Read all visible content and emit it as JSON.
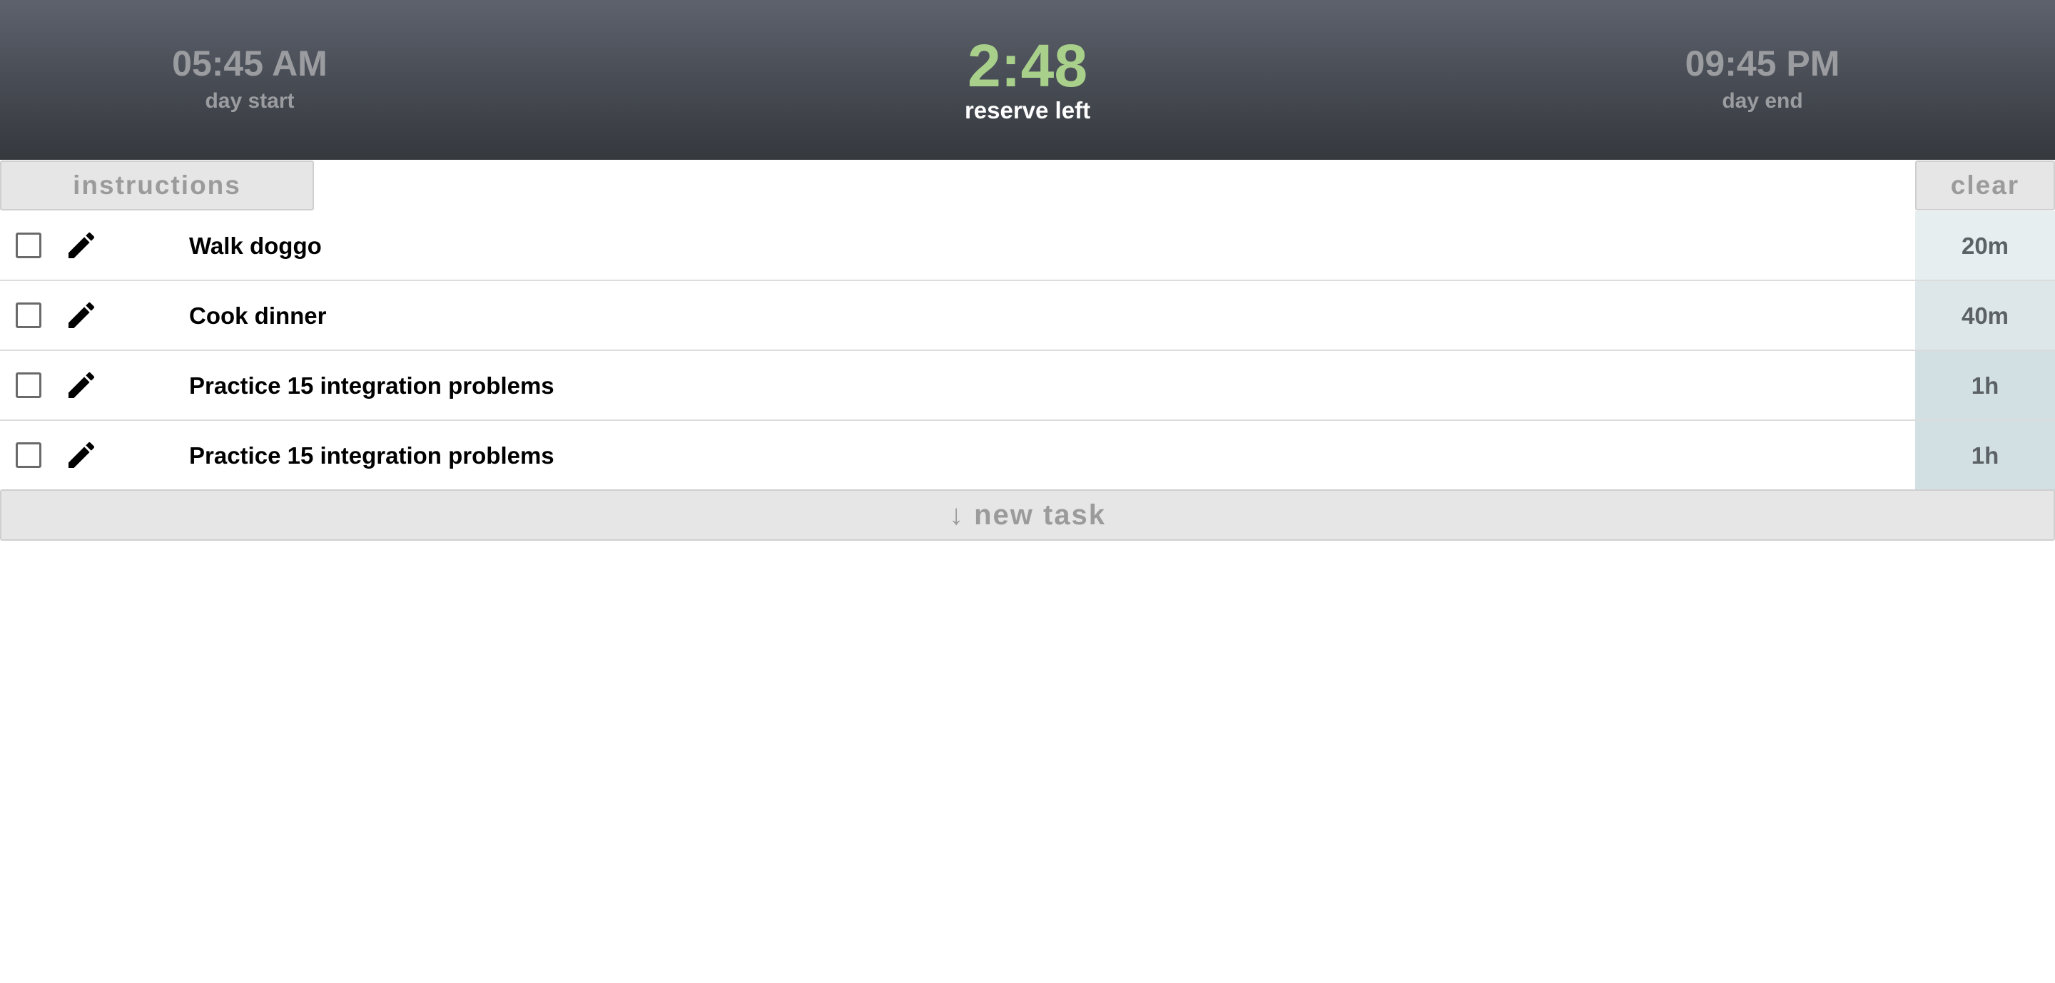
{
  "header": {
    "day_start_time": "05:45 AM",
    "day_start_label": "day start",
    "reserve_value": "2:48",
    "reserve_label": "reserve left",
    "day_end_time": "09:45 PM",
    "day_end_label": "day end"
  },
  "buttons": {
    "instructions": "instructions",
    "clear": "clear",
    "new_task": "↓ new task"
  },
  "tasks": [
    {
      "name": "Walk doggo",
      "duration": "20m",
      "checked": false,
      "duration_bg": "#e6eef0"
    },
    {
      "name": "Cook dinner",
      "duration": "40m",
      "checked": false,
      "duration_bg": "#dde7ea"
    },
    {
      "name": "Practice 15 integration problems",
      "duration": "1h",
      "checked": false,
      "duration_bg": "#d2dfe3"
    },
    {
      "name": "Practice 15 integration problems",
      "duration": "1h",
      "checked": false,
      "duration_bg": "#d2dfe3"
    }
  ],
  "icons": {
    "checkbox": "checkbox-icon",
    "edit": "pencil-icon"
  },
  "colors": {
    "reserve_accent": "#a8d08a",
    "header_text": "#9a9ca0"
  }
}
